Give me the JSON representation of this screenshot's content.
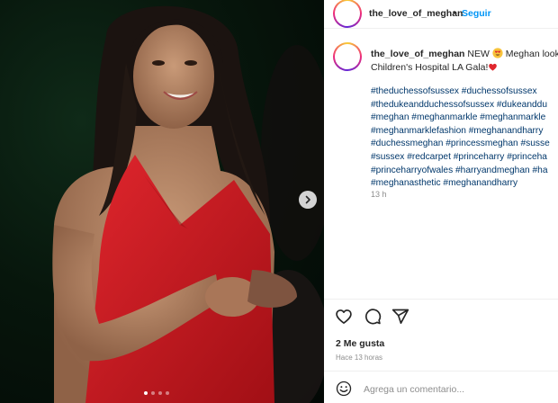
{
  "post": {
    "username": "the_love_of_meghan",
    "separator": "•",
    "follow_label": "Seguir"
  },
  "caption": {
    "username": "the_love_of_meghan",
    "line1_text": "NEW",
    "line1_after_emoji": "Meghan look",
    "line2": "Children's Hospital LA Gala!",
    "emoji_1": "heart-eyes-emoji",
    "emoji_2": "red-heart-emoji"
  },
  "hashtags": [
    "#theduchessofsussex #duchessofsussex",
    "#thedukeandduchessofsussex #dukeanddu",
    "#meghan #meghanmarkle #meghanmarkle",
    "#meghanmarklefashion #meghanandharry",
    "#duchessmeghan #princessmeghan #susse",
    "#sussex #redcarpet #princeharry #princeha",
    "#princeharryofwales #harryandmeghan #ha",
    "#meghanasthetic #meghanandharry"
  ],
  "time_short": "13 h",
  "likes": "2 Me gusta",
  "time_ago": "Hace 13 horas",
  "comment": {
    "placeholder": "Agrega un comentario..."
  },
  "icons": {
    "like": "heart-outline-icon",
    "comment": "comment-bubble-icon",
    "share": "paper-plane-icon",
    "emoji": "smiley-face-icon",
    "next": "chevron-right-icon"
  },
  "colors": {
    "link": "#0095f6",
    "hashtag": "#00376b",
    "muted": "#8e8e8e",
    "dress": "#c8161d"
  },
  "carousel": {
    "dot_count": 4,
    "active_index": 0
  }
}
